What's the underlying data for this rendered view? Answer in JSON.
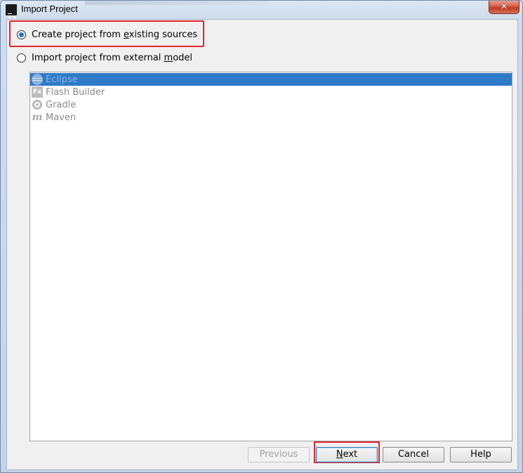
{
  "window": {
    "title": "Import Project",
    "app_icon_letter": "IJ",
    "close_label": "✕"
  },
  "options": [
    {
      "label_before": "Create project from ",
      "label_mnemonic": "e",
      "label_after": "xisting sources",
      "selected": true
    },
    {
      "label_before": "Import project from external ",
      "label_mnemonic": "m",
      "label_after": "odel",
      "selected": false
    }
  ],
  "models": [
    {
      "label": "Eclipse",
      "icon": "eclipse-icon",
      "selected": true
    },
    {
      "label": "Flash Builder",
      "icon": "flash-builder-icon",
      "icon_text": "Fx",
      "selected": false
    },
    {
      "label": "Gradle",
      "icon": "gradle-icon",
      "selected": false
    },
    {
      "label": "Maven",
      "icon": "maven-icon",
      "icon_text": "m",
      "selected": false
    }
  ],
  "buttons": {
    "previous": "Previous",
    "next_mnemonic": "N",
    "next_rest": "ext",
    "cancel": "Cancel",
    "help": "Help"
  },
  "colors": {
    "selection": "#2d7ac9",
    "highlight": "#e0252e",
    "radio_dot": "#2a72c9"
  }
}
